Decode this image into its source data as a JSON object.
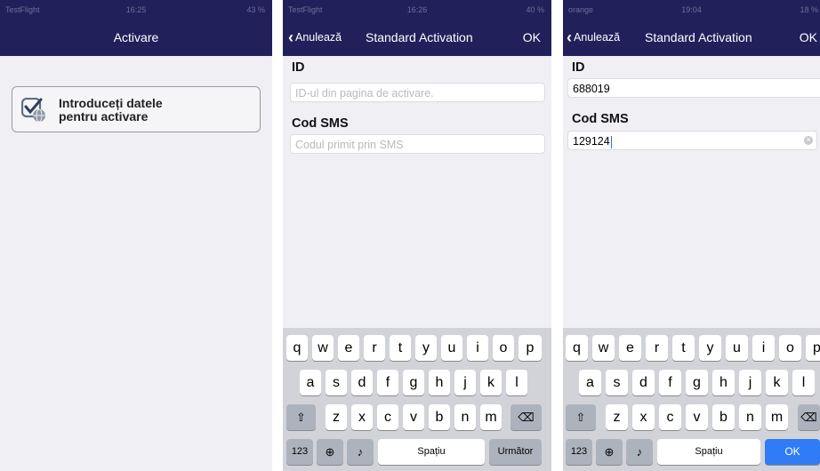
{
  "screen1": {
    "status": {
      "carrier": "TestFlight",
      "time": "16:25",
      "battery": "43 %"
    },
    "nav_title": "Activare",
    "activate_button": {
      "line1": "Introduceți datele",
      "line2": "pentru activare",
      "icon": "check-globe-icon"
    }
  },
  "screen2": {
    "status": {
      "carrier": "TestFlight",
      "time": "16:26",
      "battery": "40 %"
    },
    "back_label": "Anulează",
    "nav_title": "Standard Activation",
    "ok_label": "OK",
    "id_label": "ID",
    "id_placeholder": "ID-ul din pagina de activare.",
    "sms_label": "Cod SMS",
    "sms_placeholder": "Codul primit prin SMS",
    "keyboard": {
      "row1": [
        "q",
        "w",
        "e",
        "r",
        "t",
        "y",
        "u",
        "i",
        "o",
        "p"
      ],
      "row2": [
        "a",
        "s",
        "d",
        "f",
        "g",
        "h",
        "j",
        "k",
        "l"
      ],
      "row3": [
        "z",
        "x",
        "c",
        "v",
        "b",
        "n",
        "m"
      ],
      "numbers_key": "123",
      "space_key": "Spațiu",
      "return_key": "Următor"
    }
  },
  "screen3": {
    "status": {
      "carrier": "orange",
      "time": "19:04",
      "battery": "18 %"
    },
    "back_label": "Anulează",
    "nav_title": "Standard Activation",
    "ok_label": "OK",
    "id_label": "ID",
    "id_value": "688019",
    "sms_label": "Cod SMS",
    "sms_value": "129124",
    "keyboard": {
      "row1": [
        "q",
        "w",
        "e",
        "r",
        "t",
        "y",
        "u",
        "i",
        "o",
        "p"
      ],
      "row2": [
        "a",
        "s",
        "d",
        "f",
        "g",
        "h",
        "j",
        "k",
        "l"
      ],
      "row3": [
        "z",
        "x",
        "c",
        "v",
        "b",
        "n",
        "m"
      ],
      "numbers_key": "123",
      "space_key": "Spațiu",
      "return_key": "OK"
    }
  },
  "colors": {
    "navbar": "#21205a",
    "background": "#efeff4",
    "keyboard": "#d1d3d9",
    "key_blue": "#2f7cf6"
  }
}
